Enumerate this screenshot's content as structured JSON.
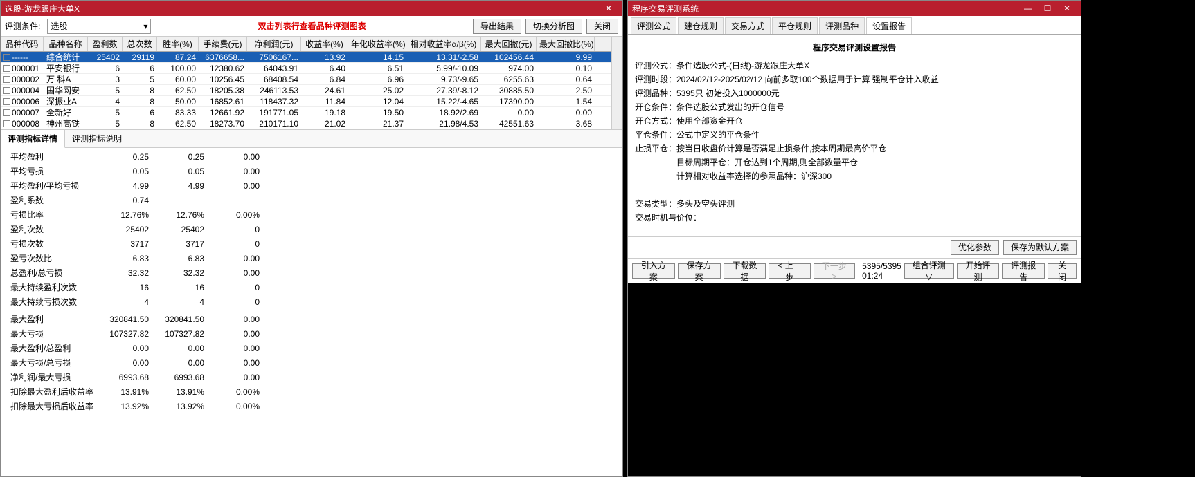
{
  "left": {
    "title": "选股-游龙跟庄大单X",
    "toolbar": {
      "cond_label": "评测条件:",
      "cond_value": "选股",
      "hint": "双击列表行查看品种评测图表",
      "export_btn": "导出结果",
      "switch_btn": "切换分析图",
      "close_btn": "关闭"
    },
    "columns": [
      "品种代码",
      "品种名称",
      "盈利数",
      "总次数",
      "胜率(%)",
      "手续费(元)",
      "净利润(元)",
      "收益率(%)",
      "年化收益率(%)",
      "相对收益率α/β(%)",
      "最大回撤(元)",
      "最大回撤比(%)"
    ],
    "rows": [
      {
        "sel": true,
        "code": "------",
        "name": "综合统计",
        "c2": "25402",
        "c3": "29119",
        "c4": "87.24",
        "c5": "6376658...",
        "c6": "7506167...",
        "c7": "13.92",
        "c8": "14.15",
        "c9": "13.31/-2.58",
        "c10": "102456.44",
        "c11": "9.99"
      },
      {
        "code": "000001",
        "name": "平安银行",
        "c2": "6",
        "c3": "6",
        "c4": "100.00",
        "c5": "12380.62",
        "c6": "64043.91",
        "c7": "6.40",
        "c8": "6.51",
        "c9": "5.99/-10.09",
        "c10": "974.00",
        "c11": "0.10"
      },
      {
        "code": "000002",
        "name": "万 科A",
        "c2": "3",
        "c3": "5",
        "c4": "60.00",
        "c5": "10256.45",
        "c6": "68408.54",
        "c7": "6.84",
        "c8": "6.96",
        "c9": "9.73/-9.65",
        "c10": "6255.63",
        "c11": "0.64"
      },
      {
        "code": "000004",
        "name": "国华网安",
        "c2": "5",
        "c3": "8",
        "c4": "62.50",
        "c5": "18205.38",
        "c6": "246113.53",
        "c7": "24.61",
        "c8": "25.02",
        "c9": "27.39/-8.12",
        "c10": "30885.50",
        "c11": "2.50"
      },
      {
        "code": "000006",
        "name": "深振业A",
        "c2": "4",
        "c3": "8",
        "c4": "50.00",
        "c5": "16852.61",
        "c6": "118437.32",
        "c7": "11.84",
        "c8": "12.04",
        "c9": "15.22/-4.65",
        "c10": "17390.00",
        "c11": "1.54"
      },
      {
        "code": "000007",
        "name": "全新好",
        "c2": "5",
        "c3": "6",
        "c4": "83.33",
        "c5": "12661.92",
        "c6": "191771.05",
        "c7": "19.18",
        "c8": "19.50",
        "c9": "18.92/2.69",
        "c10": "0.00",
        "c11": "0.00"
      },
      {
        "code": "000008",
        "name": "神州高铁",
        "c2": "5",
        "c3": "8",
        "c4": "62.50",
        "c5": "18273.70",
        "c6": "210171.10",
        "c7": "21.02",
        "c8": "21.37",
        "c9": "21.98/4.53",
        "c10": "42551.63",
        "c11": "3.68"
      }
    ],
    "tabs": {
      "t1": "评测指标详情",
      "t2": "评测指标说明"
    },
    "metrics": [
      {
        "lab": "平均盈利",
        "v1": "0.25",
        "v2": "0.25",
        "v3": "0.00"
      },
      {
        "lab": "平均亏损",
        "v1": "0.05",
        "v2": "0.05",
        "v3": "0.00"
      },
      {
        "lab": "平均盈利/平均亏损",
        "v1": "4.99",
        "v2": "4.99",
        "v3": "0.00"
      },
      {
        "lab": "盈利系数",
        "v1": "0.74",
        "v2": "",
        "v3": ""
      },
      {
        "lab": "亏损比率",
        "v1": "12.76%",
        "v2": "12.76%",
        "v3": "0.00%"
      },
      {
        "lab": "盈利次数",
        "v1": "25402",
        "v2": "25402",
        "v3": "0"
      },
      {
        "lab": "亏损次数",
        "v1": "3717",
        "v2": "3717",
        "v3": "0"
      },
      {
        "lab": "盈亏次数比",
        "v1": "6.83",
        "v2": "6.83",
        "v3": "0.00"
      },
      {
        "lab": "总盈利/总亏损",
        "v1": "32.32",
        "v2": "32.32",
        "v3": "0.00"
      },
      {
        "lab": "最大持续盈利次数",
        "v1": "16",
        "v2": "16",
        "v3": "0"
      },
      {
        "lab": "最大持续亏损次数",
        "v1": "4",
        "v2": "4",
        "v3": "0"
      },
      {
        "lab": "",
        "v1": "",
        "v2": "",
        "v3": ""
      },
      {
        "lab": "最大盈利",
        "v1": "320841.50",
        "v2": "320841.50",
        "v3": "0.00"
      },
      {
        "lab": "最大亏损",
        "v1": "107327.82",
        "v2": "107327.82",
        "v3": "0.00"
      },
      {
        "lab": "最大盈利/总盈利",
        "v1": "0.00",
        "v2": "0.00",
        "v3": "0.00"
      },
      {
        "lab": "最大亏损/总亏损",
        "v1": "0.00",
        "v2": "0.00",
        "v3": "0.00"
      },
      {
        "lab": "净利润/最大亏损",
        "v1": "6993.68",
        "v2": "6993.68",
        "v3": "0.00"
      },
      {
        "lab": "扣除最大盈利后收益率",
        "v1": "13.91%",
        "v2": "13.91%",
        "v3": "0.00%"
      },
      {
        "lab": "扣除最大亏损后收益率",
        "v1": "13.92%",
        "v2": "13.92%",
        "v3": "0.00%"
      }
    ]
  },
  "right": {
    "title": "程序交易评测系统",
    "tabs": [
      "评测公式",
      "建仓规则",
      "交易方式",
      "平仓规则",
      "评测品种",
      "设置报告"
    ],
    "report": {
      "heading": "程序交易评测设置报告",
      "l1": "评测公式：条件选股公式-(日线)-游龙跟庄大单X",
      "l2": "评测时段：2024/02/12-2025/02/12 向前多取100个数据用于计算 强制平仓计入收益",
      "l3": "评测品种：5395只 初始投入1000000元",
      "l4": "开仓条件：条件选股公式发出的开仓信号",
      "l5": "开仓方式：使用全部资金开仓",
      "l6": "平仓条件：公式中定义的平仓条件",
      "l7": "止损平仓：按当日收盘价计算是否满足止损条件,按本周期最高价平仓",
      "l8": "目标周期平仓：开仓达到1个周期,则全部数量平仓",
      "l9": "计算相对收益率选择的参照品种：沪深300",
      "l10": "交易类型：多头及空头评测",
      "l11": "交易时机与价位："
    },
    "btn1": {
      "opt": "优化参数",
      "save_default": "保存为默认方案"
    },
    "btn2": {
      "import": "引入方案",
      "save": "保存方案",
      "download": "下载数据",
      "prev": "< 上一步",
      "next": "下一步 >",
      "status": "5395/5395 01:24",
      "combo": "组合评测∨",
      "start": "开始评测",
      "report": "评测报告",
      "close": "关闭"
    }
  }
}
